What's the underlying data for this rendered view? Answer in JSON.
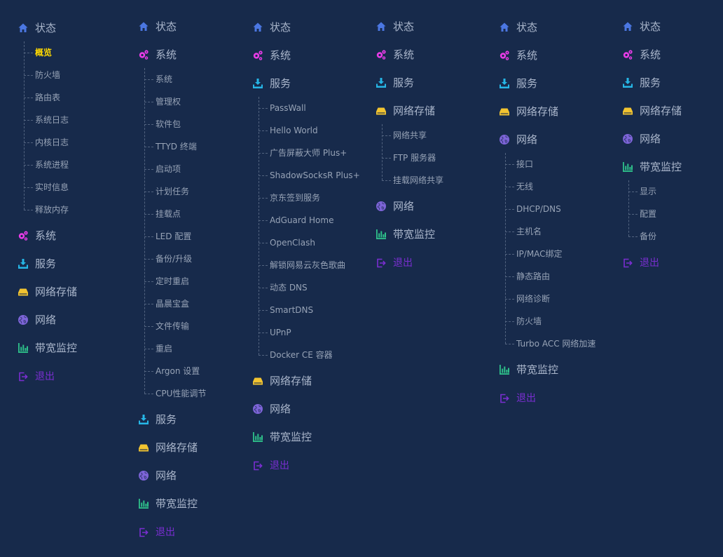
{
  "colors": {
    "background": "#172a4b",
    "status_icon": "#4b77e2",
    "system_icon": "#e93ce8",
    "services_icon": "#26b6e6",
    "nas_icon": "#f2c430",
    "network_icon": "#7d64d8",
    "bandwidth_icon": "#2ec08a",
    "logout": "#7a2ed1",
    "active_item": "#ffd900"
  },
  "columns": [
    {
      "menus": [
        {
          "id": "status",
          "icon": "home-icon",
          "label": "状态",
          "expanded": true,
          "children": [
            {
              "label": "概览",
              "active": true
            },
            {
              "label": "防火墙"
            },
            {
              "label": "路由表"
            },
            {
              "label": "系统日志"
            },
            {
              "label": "内核日志"
            },
            {
              "label": "系统进程"
            },
            {
              "label": "实时信息"
            },
            {
              "label": "释放内存"
            }
          ]
        },
        {
          "id": "system",
          "icon": "gear-icon",
          "label": "系统"
        },
        {
          "id": "services",
          "icon": "download-icon",
          "label": "服务"
        },
        {
          "id": "nas",
          "icon": "storage-icon",
          "label": "网络存储"
        },
        {
          "id": "network",
          "icon": "globe-icon",
          "label": "网络"
        },
        {
          "id": "bandwidth",
          "icon": "bar-chart-icon",
          "label": "带宽监控"
        },
        {
          "id": "logout",
          "icon": "logout-icon",
          "label": "退出"
        }
      ]
    },
    {
      "menus": [
        {
          "id": "status",
          "icon": "home-icon",
          "label": "状态"
        },
        {
          "id": "system",
          "icon": "gear-icon",
          "label": "系统",
          "expanded": true,
          "children": [
            {
              "label": "系统"
            },
            {
              "label": "管理权"
            },
            {
              "label": "软件包"
            },
            {
              "label": "TTYD 终端"
            },
            {
              "label": "启动项"
            },
            {
              "label": "计划任务"
            },
            {
              "label": "挂载点"
            },
            {
              "label": "LED 配置"
            },
            {
              "label": "备份/升级"
            },
            {
              "label": "定时重启"
            },
            {
              "label": "晶晨宝盒"
            },
            {
              "label": "文件传输"
            },
            {
              "label": "重启"
            },
            {
              "label": "Argon 设置"
            },
            {
              "label": "CPU性能调节"
            }
          ]
        },
        {
          "id": "services",
          "icon": "download-icon",
          "label": "服务"
        },
        {
          "id": "nas",
          "icon": "storage-icon",
          "label": "网络存储"
        },
        {
          "id": "network",
          "icon": "globe-icon",
          "label": "网络"
        },
        {
          "id": "bandwidth",
          "icon": "bar-chart-icon",
          "label": "带宽监控"
        },
        {
          "id": "logout",
          "icon": "logout-icon",
          "label": "退出"
        }
      ]
    },
    {
      "menus": [
        {
          "id": "status",
          "icon": "home-icon",
          "label": "状态"
        },
        {
          "id": "system",
          "icon": "gear-icon",
          "label": "系统"
        },
        {
          "id": "services",
          "icon": "download-icon",
          "label": "服务",
          "expanded": true,
          "children": [
            {
              "label": "PassWall"
            },
            {
              "label": "Hello World"
            },
            {
              "label": "广告屏蔽大师 Plus+"
            },
            {
              "label": "ShadowSocksR Plus+"
            },
            {
              "label": "京东签到服务"
            },
            {
              "label": "AdGuard Home"
            },
            {
              "label": "OpenClash"
            },
            {
              "label": "解锁网易云灰色歌曲"
            },
            {
              "label": "动态 DNS"
            },
            {
              "label": "SmartDNS"
            },
            {
              "label": "UPnP"
            },
            {
              "label": "Docker CE 容器"
            }
          ]
        },
        {
          "id": "nas",
          "icon": "storage-icon",
          "label": "网络存储"
        },
        {
          "id": "network",
          "icon": "globe-icon",
          "label": "网络"
        },
        {
          "id": "bandwidth",
          "icon": "bar-chart-icon",
          "label": "带宽监控"
        },
        {
          "id": "logout",
          "icon": "logout-icon",
          "label": "退出"
        }
      ]
    },
    {
      "menus": [
        {
          "id": "status",
          "icon": "home-icon",
          "label": "状态"
        },
        {
          "id": "system",
          "icon": "gear-icon",
          "label": "系统"
        },
        {
          "id": "services",
          "icon": "download-icon",
          "label": "服务"
        },
        {
          "id": "nas",
          "icon": "storage-icon",
          "label": "网络存储",
          "expanded": true,
          "children": [
            {
              "label": "网络共享"
            },
            {
              "label": "FTP 服务器"
            },
            {
              "label": "挂载网络共享"
            }
          ]
        },
        {
          "id": "network",
          "icon": "globe-icon",
          "label": "网络"
        },
        {
          "id": "bandwidth",
          "icon": "bar-chart-icon",
          "label": "带宽监控"
        },
        {
          "id": "logout",
          "icon": "logout-icon",
          "label": "退出"
        }
      ]
    },
    {
      "menus": [
        {
          "id": "status",
          "icon": "home-icon",
          "label": "状态"
        },
        {
          "id": "system",
          "icon": "gear-icon",
          "label": "系统"
        },
        {
          "id": "services",
          "icon": "download-icon",
          "label": "服务"
        },
        {
          "id": "nas",
          "icon": "storage-icon",
          "label": "网络存储"
        },
        {
          "id": "network",
          "icon": "globe-icon",
          "label": "网络",
          "expanded": true,
          "children": [
            {
              "label": "接口"
            },
            {
              "label": "无线"
            },
            {
              "label": "DHCP/DNS"
            },
            {
              "label": "主机名"
            },
            {
              "label": "IP/MAC绑定"
            },
            {
              "label": "静态路由"
            },
            {
              "label": "网络诊断"
            },
            {
              "label": "防火墙"
            },
            {
              "label": "Turbo ACC 网络加速"
            }
          ]
        },
        {
          "id": "bandwidth",
          "icon": "bar-chart-icon",
          "label": "带宽监控"
        },
        {
          "id": "logout",
          "icon": "logout-icon",
          "label": "退出"
        }
      ]
    },
    {
      "menus": [
        {
          "id": "status",
          "icon": "home-icon",
          "label": "状态"
        },
        {
          "id": "system",
          "icon": "gear-icon",
          "label": "系统"
        },
        {
          "id": "services",
          "icon": "download-icon",
          "label": "服务"
        },
        {
          "id": "nas",
          "icon": "storage-icon",
          "label": "网络存储"
        },
        {
          "id": "network",
          "icon": "globe-icon",
          "label": "网络"
        },
        {
          "id": "bandwidth",
          "icon": "bar-chart-icon",
          "label": "带宽监控",
          "expanded": true,
          "children": [
            {
              "label": "显示"
            },
            {
              "label": "配置"
            },
            {
              "label": "备份"
            }
          ]
        },
        {
          "id": "logout",
          "icon": "logout-icon",
          "label": "退出"
        }
      ]
    }
  ]
}
